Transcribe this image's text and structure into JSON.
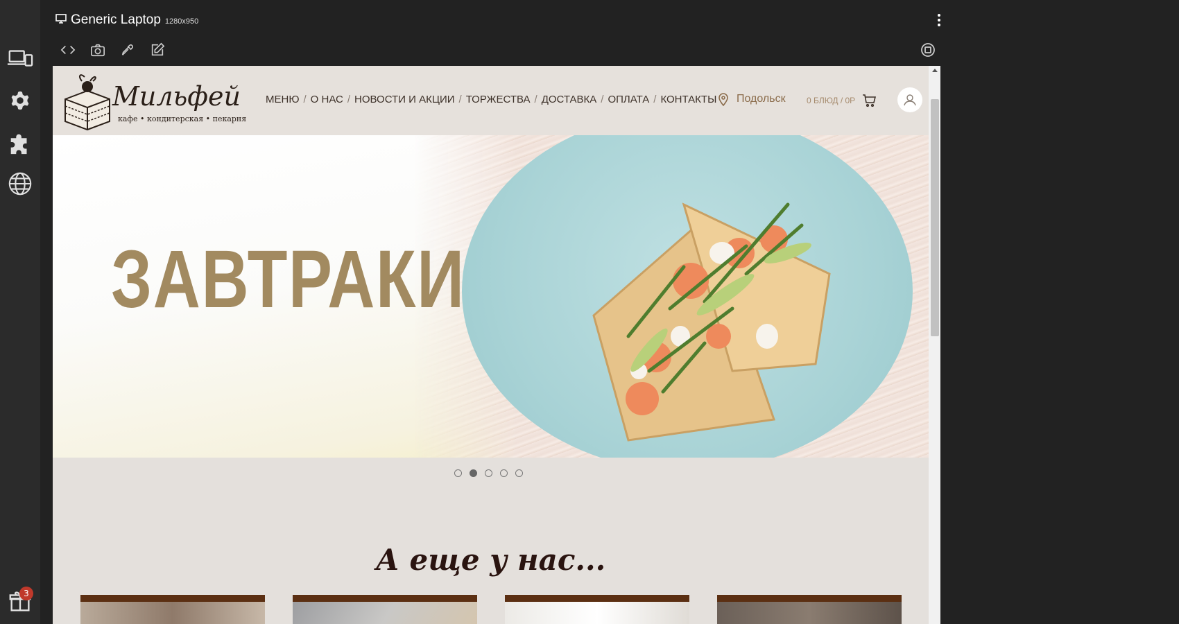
{
  "toolbar": {
    "device_name": "Generic Laptop",
    "resolution": "1280x950"
  },
  "rail": {
    "gift_badge_count": "3"
  },
  "site": {
    "logo": {
      "name": "Мильфей",
      "tagline": "кафе • кондитерская • пекарня"
    },
    "nav": [
      "МЕНЮ",
      "О НАС",
      "НОВОСТИ И АКЦИИ",
      "ТОРЖЕСТВА",
      "ДОСТАВКА",
      "ОПЛАТА",
      "КОНТАКТЫ"
    ],
    "city": "Подольск",
    "cart_summary": "0 БЛЮД / 0Р",
    "banner": {
      "title": "ЗАВТРАКИ",
      "slides_total": 5,
      "active_slide": 2
    },
    "section_title": "А еще у нас..."
  },
  "colors": {
    "app_bg": "#222222",
    "rail_bg": "#2b2b2b",
    "site_bg": "#e4e0dc",
    "banner_title": "#a28a60",
    "card_top": "#5b2f12"
  }
}
